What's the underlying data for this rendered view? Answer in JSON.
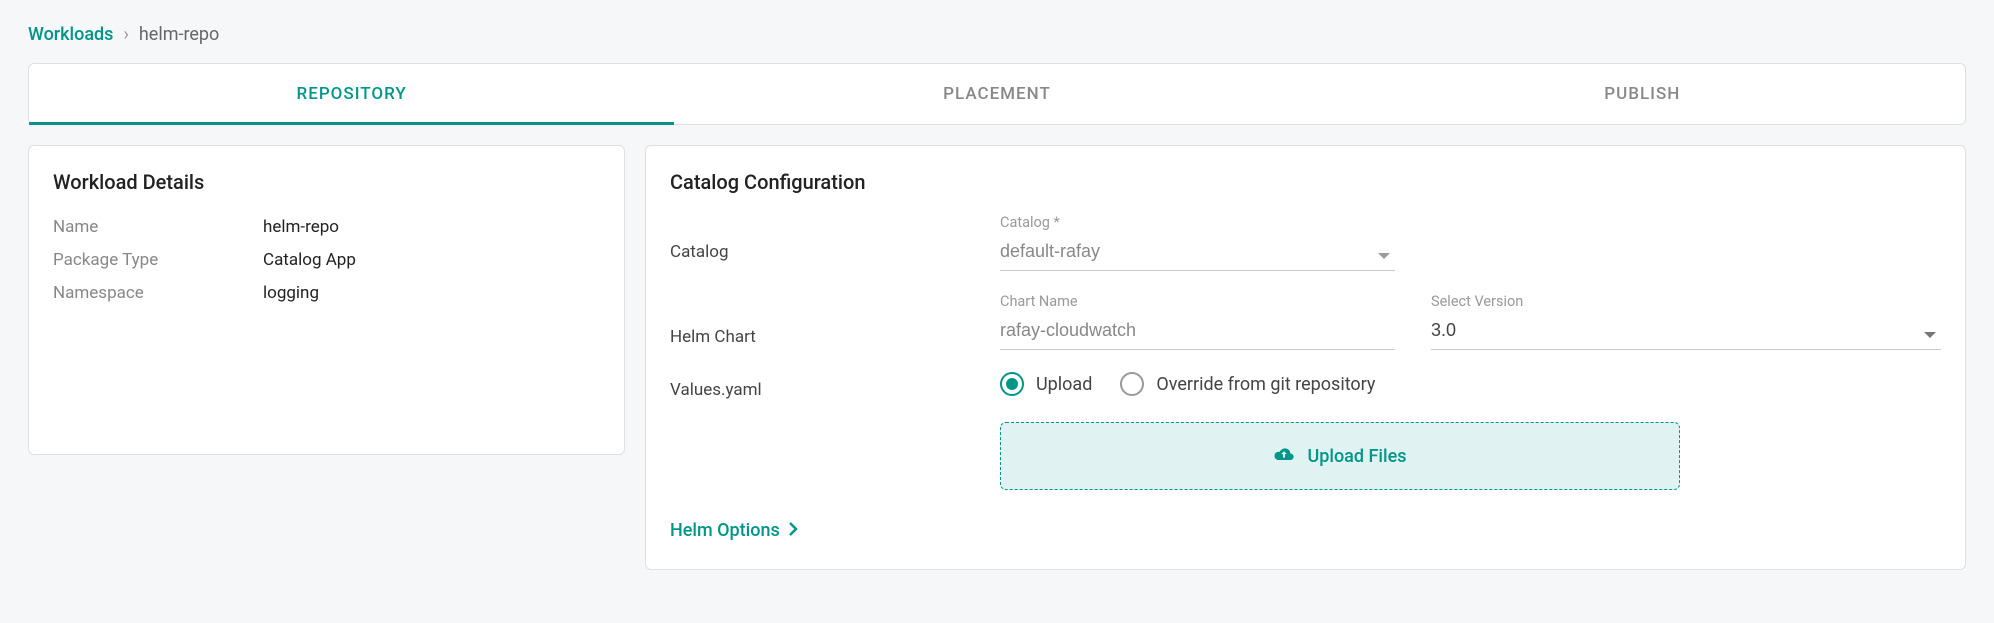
{
  "breadcrumb": {
    "root": "Workloads",
    "separator": "›",
    "current": "helm-repo"
  },
  "tabs": {
    "repository": "REPOSITORY",
    "placement": "PLACEMENT",
    "publish": "PUBLISH"
  },
  "details": {
    "title": "Workload Details",
    "name_label": "Name",
    "name_value": "helm-repo",
    "package_label": "Package Type",
    "package_value": "Catalog App",
    "namespace_label": "Namespace",
    "namespace_value": "logging"
  },
  "catalog": {
    "title": "Catalog Configuration",
    "catalog_row_label": "Catalog",
    "catalog_float_label": "Catalog *",
    "catalog_value": "default-rafay",
    "helm_row_label": "Helm Chart",
    "chart_float_label": "Chart Name",
    "chart_value": "rafay-cloudwatch",
    "version_float_label": "Select Version",
    "version_value": "3.0",
    "values_row_label": "Values.yaml",
    "radio_upload": "Upload",
    "radio_override": "Override from git repository",
    "upload_button": "Upload Files",
    "helm_options": "Helm Options"
  }
}
